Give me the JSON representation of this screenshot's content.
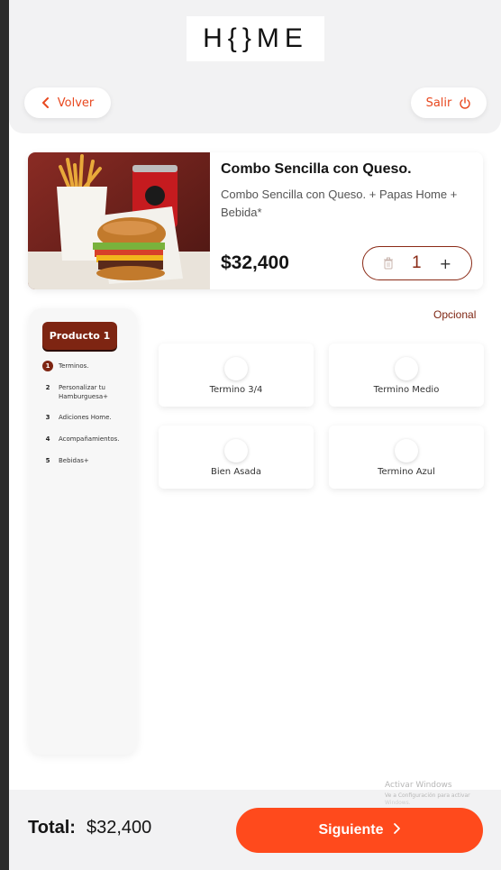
{
  "header": {
    "logo_text": "H{}ME",
    "back_label": "Volver",
    "exit_label": "Salir"
  },
  "product": {
    "title": "Combo Sencilla con Queso.",
    "description": "Combo Sencilla con Queso. + Papas Home + Bebida*",
    "price": "$32,400",
    "quantity": "1",
    "plus_label": "+"
  },
  "sidebar": {
    "product_tab": "Producto 1",
    "steps": [
      {
        "num": "1",
        "label": "Terminos.",
        "active": true
      },
      {
        "num": "2",
        "label": "Personalizar tu Hamburguesa+",
        "active": false
      },
      {
        "num": "3",
        "label": "Adiciones Home.",
        "active": false
      },
      {
        "num": "4",
        "label": "Acompañamientos.",
        "active": false
      },
      {
        "num": "5",
        "label": "Bebidas+",
        "active": false
      }
    ]
  },
  "options": {
    "optional_label": "Opcional",
    "items": [
      {
        "label": "Termino 3/4"
      },
      {
        "label": "Termino Medio"
      },
      {
        "label": "Bien Asada"
      },
      {
        "label": "Termino Azul"
      }
    ]
  },
  "footer": {
    "total_label": "Total:",
    "total_value": "$32,400",
    "next_label": "Siguiente"
  },
  "watermark": {
    "line1": "Activar Windows",
    "line2": "Ve a Configuración para activar",
    "line3": "Windows."
  },
  "colors": {
    "accent": "#ff4a1c",
    "brand_dark": "#7e2512",
    "header_bg": "#f2f2f3"
  }
}
